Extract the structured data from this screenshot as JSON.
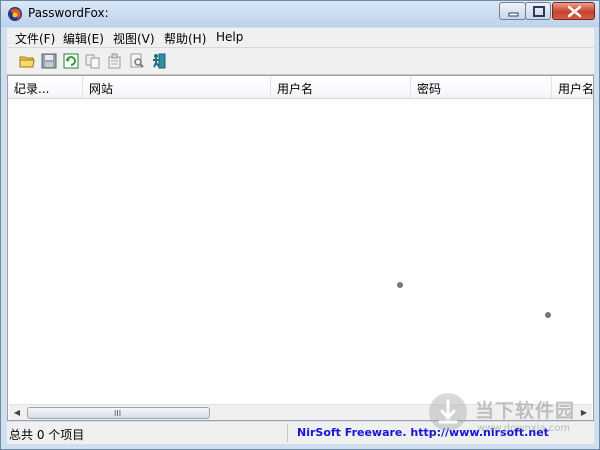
{
  "window": {
    "title": "PasswordFox:"
  },
  "menu": [
    "文件(F)",
    "编辑(E)",
    "视图(V)",
    "帮助(H)",
    "Help"
  ],
  "toolbar": {
    "icons": [
      "open-folder-icon",
      "save-icon",
      "refresh-icon",
      "copy-icon",
      "properties-icon",
      "find-icon",
      "exit-icon"
    ]
  },
  "list": {
    "columns": [
      "记录...",
      "网站",
      "用户名",
      "密码",
      "用户名"
    ],
    "sort_indicator": "/",
    "rows": []
  },
  "scrollbar": {
    "grip": "III"
  },
  "status": {
    "left": "总共 0 个项目",
    "right": "NirSoft Freeware.  http://www.nirsoft.net"
  },
  "watermark": {
    "main": "当下软件园",
    "sub": "www.downxia.com"
  },
  "colors": {
    "status_link": "#1515d6",
    "title_gradient_top": "#dbe8f6",
    "close_button": "#c7412b"
  }
}
